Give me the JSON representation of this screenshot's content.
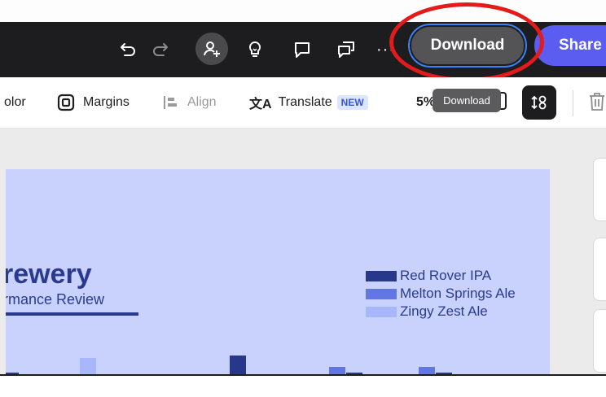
{
  "header": {
    "undo_icon": "undo-icon",
    "redo_icon": "redo-icon",
    "invite_icon": "add-person-icon",
    "ideas_icon": "lightbulb-icon",
    "comment_icon": "comment-icon",
    "present_icon": "chat-bubbles-icon",
    "more_label": "···",
    "download_label": "Download",
    "share_label": "Share"
  },
  "toolbar": {
    "color_label": "olor",
    "margins_label": "Margins",
    "align_label": "Align",
    "translate_label": "Translate",
    "translate_badge": "NEW",
    "zoom_partial": "5%",
    "tooltip_label": "Download"
  },
  "slide": {
    "title": "rewery",
    "subtitle": "rmance Review",
    "legend": [
      {
        "label": "Red Rover IPA",
        "color": "#27378a"
      },
      {
        "label": "Melton Springs Ale",
        "color": "#6276e6"
      },
      {
        "label": "Zingy Zest Ale",
        "color": "#a8b6fb"
      }
    ]
  },
  "colors": {
    "header_bg": "#1d1d1f",
    "share_button": "#5a5df0",
    "highlight_ring": "#e31b1b",
    "slide_bg": "#c9d2fc"
  }
}
